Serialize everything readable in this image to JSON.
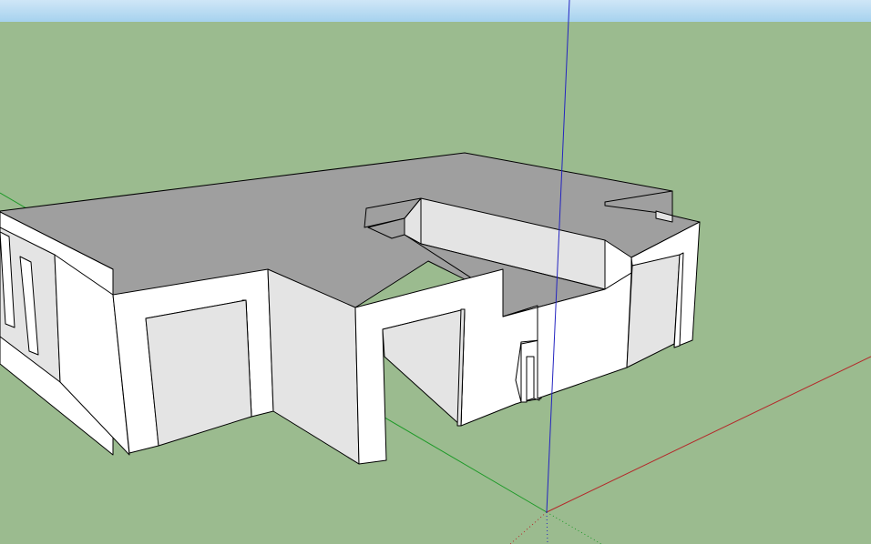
{
  "app": {
    "view": "3d-modeling-viewport",
    "colors": {
      "sky_top": "#cfe6f7",
      "sky_bottom": "#a6d2ee",
      "ground": "#9bbb8f",
      "roof": "#9f9f9f",
      "wall_lit": "#ffffff",
      "wall_shade": "#e4e4e4",
      "edge": "#000000",
      "axis_red": "#b4282a",
      "axis_green": "#1e9a28",
      "axis_blue": "#2424c0"
    },
    "icons": {
      "axes": "axes-origin-icon",
      "model": "building-model"
    }
  }
}
